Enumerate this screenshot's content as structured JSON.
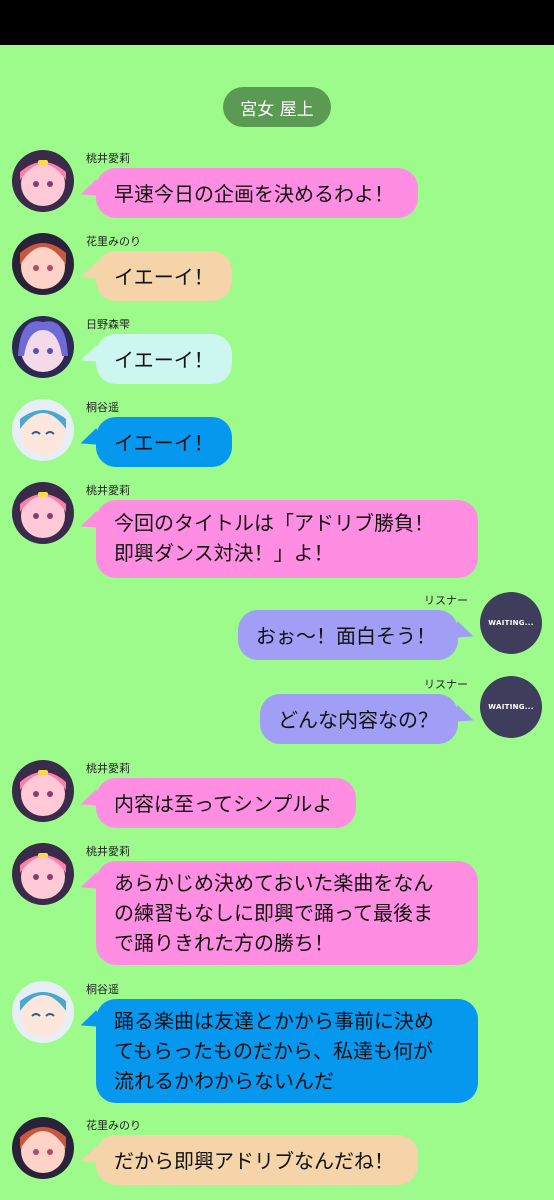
{
  "header": {
    "location": "宮女 屋上"
  },
  "colors": {
    "background": "#9dfb8c",
    "airi": "#ff8ee3",
    "minori": "#f4d4a8",
    "shizuku": "#ccf6ef",
    "haruka": "#0698ee",
    "listener": "#a19ef5"
  },
  "messages": [
    {
      "name": "桃井愛莉",
      "text": "早速今日の企画を決めるわよ！"
    },
    {
      "name": "花里みのり",
      "text": "イエーイ！"
    },
    {
      "name": "日野森雫",
      "text": "イエーイ！"
    },
    {
      "name": "桐谷遥",
      "text": "イエーイ！"
    },
    {
      "name": "桃井愛莉",
      "text": "今回のタイトルは「アドリブ勝負！\n即興ダンス対決！」よ！"
    },
    {
      "name": "リスナー",
      "text": "おぉ～！面白そう！",
      "avatar_text": "WAITING..."
    },
    {
      "name": "リスナー",
      "text": "どんな内容なの？",
      "avatar_text": "WAITING..."
    },
    {
      "name": "桃井愛莉",
      "text": "内容は至ってシンプルよ"
    },
    {
      "name": "桃井愛莉",
      "text": "あらかじめ決めておいた楽曲をなん\nの練習もなしに即興で踊って最後ま\nで踊りきれた方の勝ち！"
    },
    {
      "name": "桐谷遥",
      "text": "踊る楽曲は友達とかから事前に決め\nてもらったものだから、私達も何が\n流れるかわからないんだ"
    },
    {
      "name": "花里みのり",
      "text": "だから即興アドリブなんだね！"
    }
  ]
}
